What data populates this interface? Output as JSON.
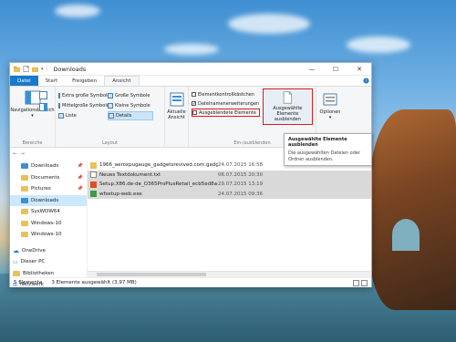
{
  "window": {
    "title": "Downloads"
  },
  "tabs": [
    {
      "label": "Datei"
    },
    {
      "label": "Start"
    },
    {
      "label": "Freigeben"
    },
    {
      "label": "Ansicht"
    }
  ],
  "ribbon": {
    "nav_pane": "Navigationsbereich",
    "group_panes": "Bereiche",
    "layout": {
      "items": [
        "Extra große Symbole",
        "Große Symbole",
        "Mittelgroße Symbole",
        "Kleine Symbole",
        "Liste",
        "Details"
      ],
      "selected": "Details",
      "label": "Layout"
    },
    "current_view": "Aktuelle Ansicht",
    "show_hide": {
      "checkbox_items": "Elementkontrollkästchen",
      "filename_ext": "Dateinamenerweiterungen",
      "hidden_items": "Ausgeblendete Elemente",
      "hide_selected": "Ausgewählte Elemente ausblenden",
      "label": "Ein-/ausblenden"
    },
    "options": "Optionen"
  },
  "tooltip": {
    "title": "Ausgewählte Elemente ausblenden",
    "body": "Die ausgewählten Dateien oder Ordner ausblenden."
  },
  "nav": [
    {
      "label": "Downloads",
      "pin": true
    },
    {
      "label": "Documents",
      "pin": true
    },
    {
      "label": "Pictures",
      "pin": true
    },
    {
      "label": "Downloads",
      "selected": true
    },
    {
      "label": "SysWOW64"
    },
    {
      "label": "Windows-10"
    },
    {
      "label": "Windows-10"
    },
    {
      "label": "OneDrive"
    },
    {
      "label": "Dieser PC"
    },
    {
      "label": "Bibliotheken"
    },
    {
      "label": "Netzwerk"
    }
  ],
  "files": [
    {
      "name": "1966_aeroxpugauge_gadgetsrevived.com.gadget",
      "date": "24.07.2015 16:58"
    },
    {
      "name": "Neues Textdokument.txt",
      "date": "06.07.2015 20:30"
    },
    {
      "name": "Setup.X86.de-de_O365ProPlusRetail_ecb5ed8a-...",
      "date": "29.07.2015 13:19"
    },
    {
      "name": "wfsetup-web.exe",
      "date": "24.07.2015 09:36"
    }
  ],
  "status": {
    "count": "5 Elemente",
    "selected": "3 Elemente ausgewählt (3,97 MB)"
  }
}
